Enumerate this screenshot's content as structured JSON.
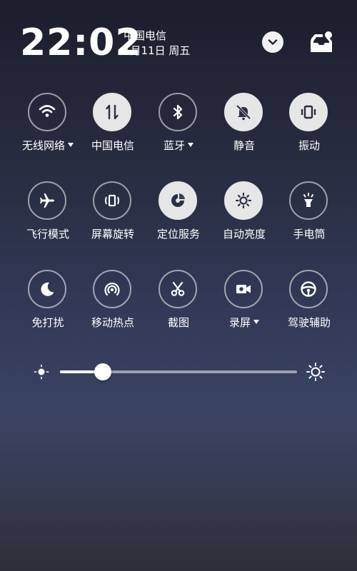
{
  "header": {
    "time": "22:02",
    "carrier": "中国电信",
    "date": "1月11日 周五"
  },
  "tiles": [
    {
      "label": "无线网络",
      "icon": "wifi-icon",
      "on": false,
      "caret": true
    },
    {
      "label": "中国电信",
      "icon": "mobile-data-icon",
      "on": true,
      "caret": false
    },
    {
      "label": "蓝牙",
      "icon": "bluetooth-icon",
      "on": false,
      "caret": true
    },
    {
      "label": "静音",
      "icon": "bell-off-icon",
      "on": true,
      "caret": false
    },
    {
      "label": "振动",
      "icon": "vibrate-icon",
      "on": true,
      "caret": false
    },
    {
      "label": "飞行模式",
      "icon": "airplane-icon",
      "on": false,
      "caret": false
    },
    {
      "label": "屏幕旋转",
      "icon": "screen-rotate-icon",
      "on": false,
      "caret": false
    },
    {
      "label": "定位服务",
      "icon": "location-icon",
      "on": true,
      "caret": false
    },
    {
      "label": "自动亮度",
      "icon": "auto-brightness-icon",
      "on": true,
      "caret": false
    },
    {
      "label": "手电筒",
      "icon": "flashlight-icon",
      "on": false,
      "caret": false
    },
    {
      "label": "免打扰",
      "icon": "moon-icon",
      "on": false,
      "caret": false
    },
    {
      "label": "移动热点",
      "icon": "hotspot-icon",
      "on": false,
      "caret": false
    },
    {
      "label": "截图",
      "icon": "scissors-icon",
      "on": false,
      "caret": false
    },
    {
      "label": "录屏",
      "icon": "screen-record-icon",
      "on": false,
      "caret": true
    },
    {
      "label": "驾驶辅助",
      "icon": "steering-wheel-icon",
      "on": false,
      "caret": false
    }
  ],
  "brightness": {
    "level": 0.18
  },
  "colors": {
    "tile_on_bg": "#e6e6e6",
    "tile_on_icon": "#2b2f45",
    "tile_off_icon": "#ffffff"
  }
}
